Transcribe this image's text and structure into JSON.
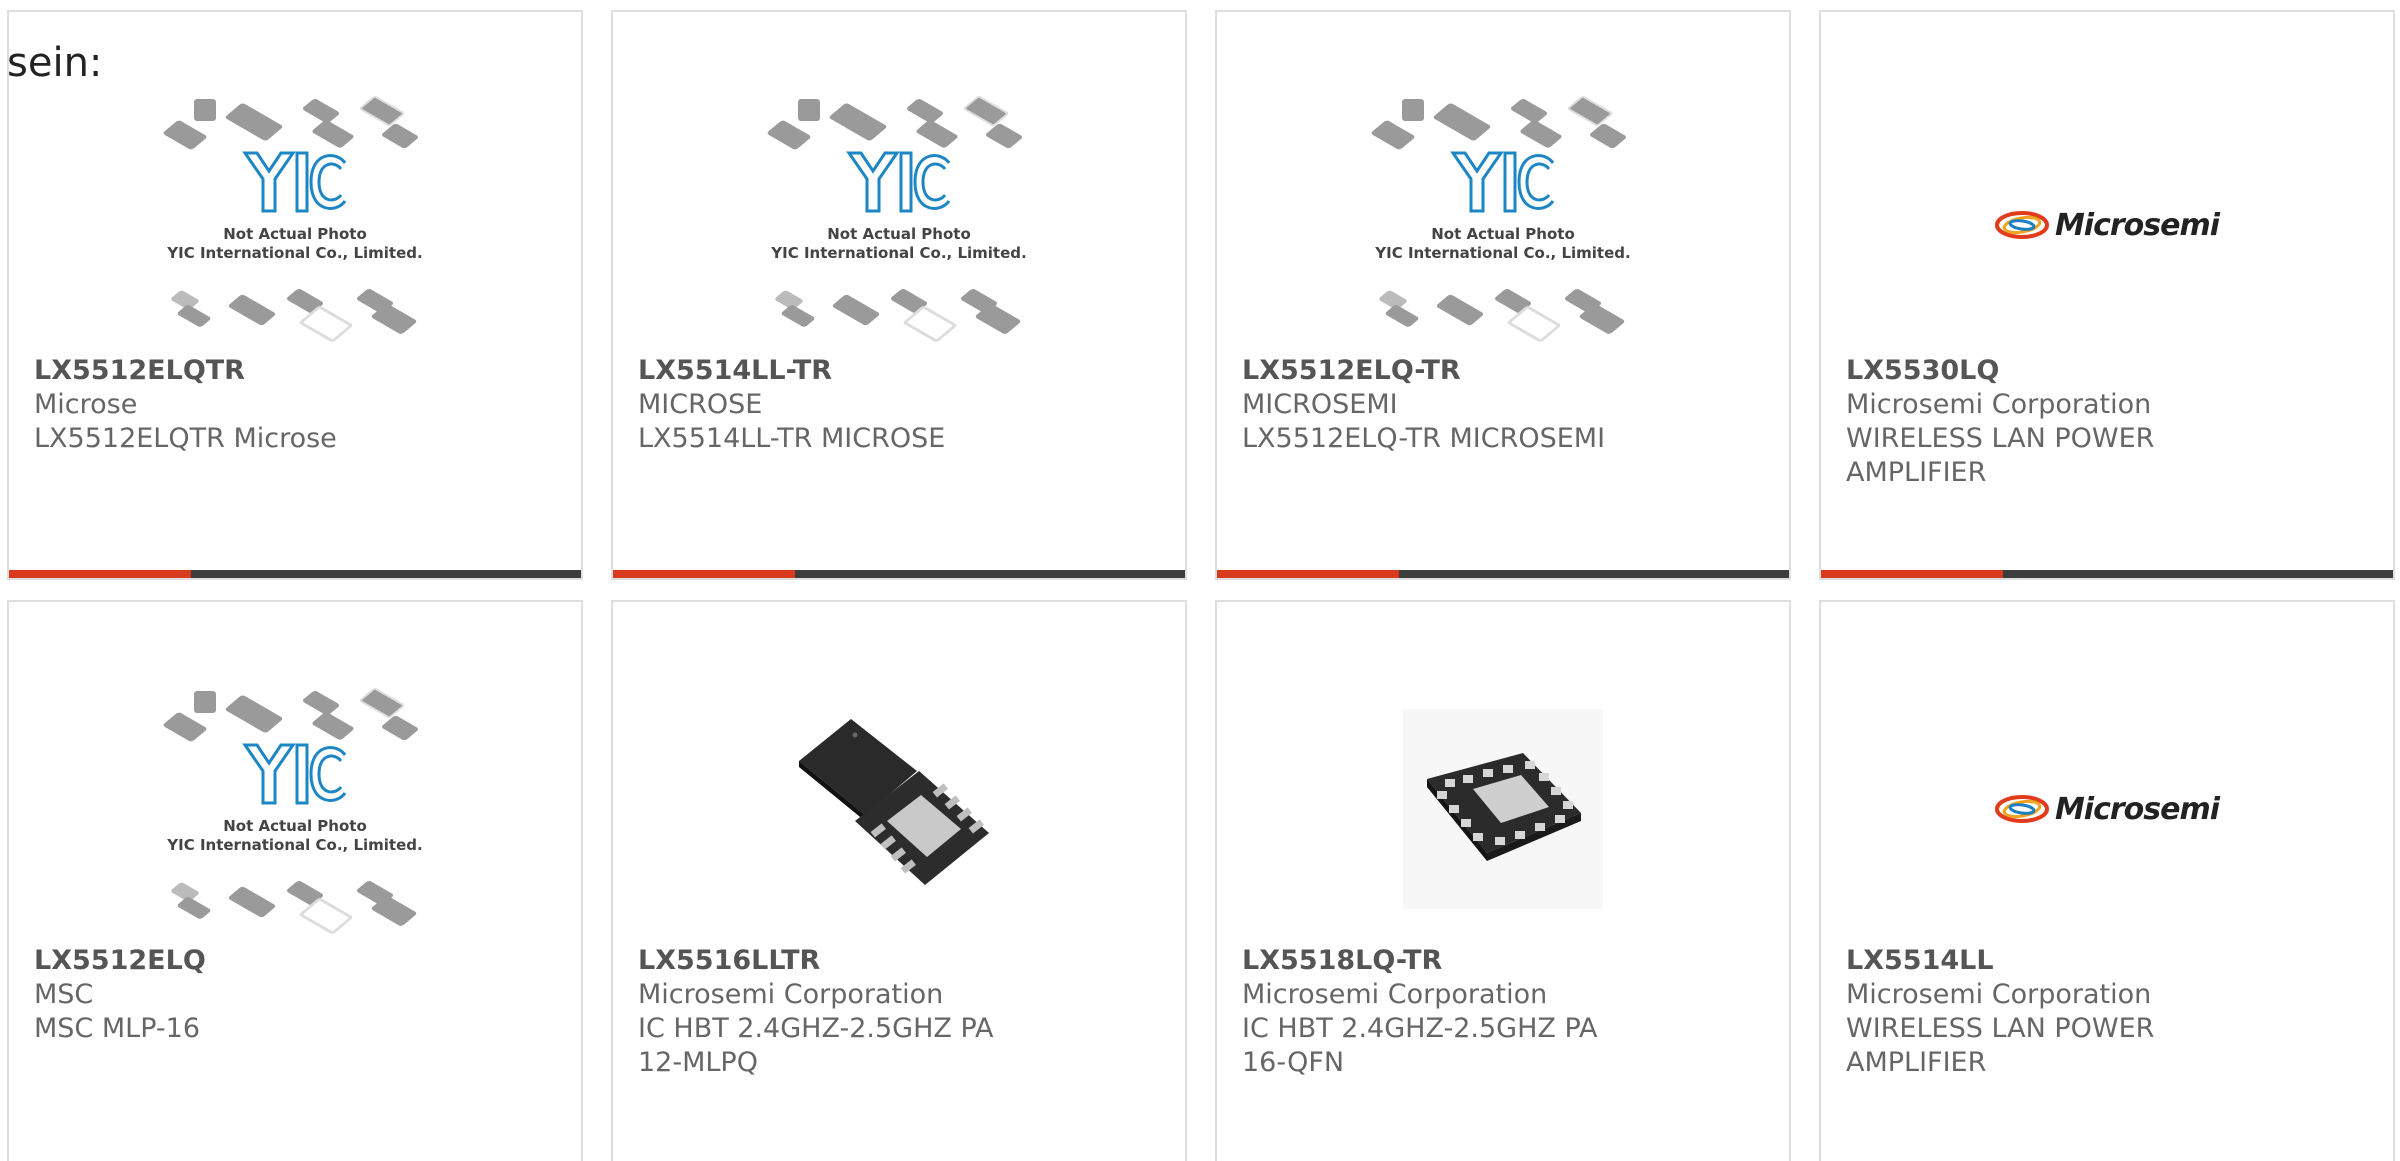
{
  "intro_text": "sein:",
  "placeholder": {
    "caption_line1": "Not Actual Photo",
    "caption_line2": "YIC International Co., Limited."
  },
  "brand_logo_text": "Microsemi",
  "colors": {
    "accent": "#d9391c",
    "bar": "#3d3d3d",
    "border": "#dedede"
  },
  "products": [
    {
      "part": "LX5512ELQTR",
      "manufacturer": "Microse",
      "description": "LX5512ELQTR Microse",
      "image": "yic-placeholder"
    },
    {
      "part": "LX5514LL-TR",
      "manufacturer": "MICROSE",
      "description": "LX5514LL-TR MICROSE",
      "image": "yic-placeholder"
    },
    {
      "part": "LX5512ELQ-TR",
      "manufacturer": "MICROSEMI",
      "description": "LX5512ELQ-TR MICROSEMI",
      "image": "yic-placeholder"
    },
    {
      "part": "LX5530LQ",
      "manufacturer": "Microsemi Corporation",
      "description": "WIRELESS LAN POWER AMPLIFIER",
      "image": "microsemi-logo"
    },
    {
      "part": "LX5512ELQ",
      "manufacturer": "MSC",
      "description": "MSC MLP-16",
      "image": "yic-placeholder"
    },
    {
      "part": "LX5516LLTR",
      "manufacturer": "Microsemi Corporation",
      "description": "IC HBT 2.4GHZ-2.5GHZ PA 12-MLPQ",
      "image": "qfn-chip-photo"
    },
    {
      "part": "LX5518LQ-TR",
      "manufacturer": "Microsemi Corporation",
      "description": "IC HBT 2.4GHZ-2.5GHZ PA 16-QFN",
      "image": "qfn16-chip-photo"
    },
    {
      "part": "LX5514LL",
      "manufacturer": "Microsemi Corporation",
      "description": "WIRELESS LAN POWER AMPLIFIER",
      "image": "microsemi-logo"
    }
  ]
}
